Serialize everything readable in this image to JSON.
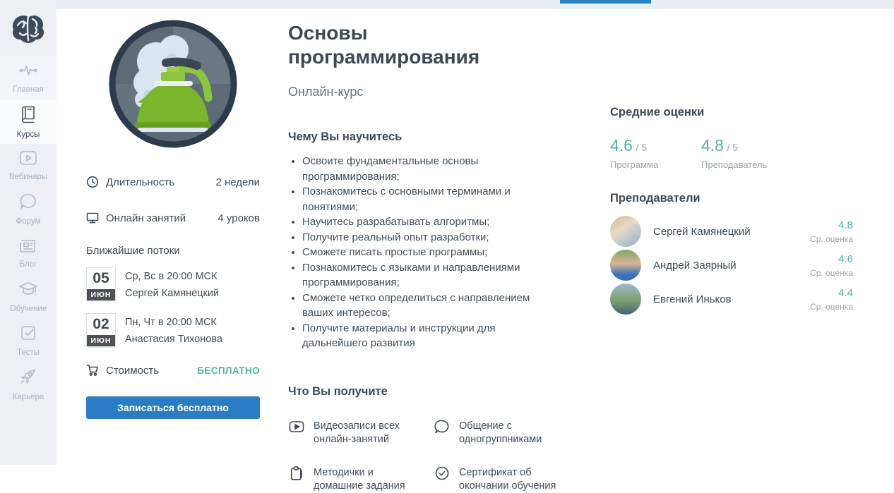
{
  "sidebar": {
    "items": [
      {
        "label": "Главная",
        "icon": "pulse-icon"
      },
      {
        "label": "Курсы",
        "icon": "book-icon"
      },
      {
        "label": "Вебинары",
        "icon": "webinar-icon"
      },
      {
        "label": "Форум",
        "icon": "forum-icon"
      },
      {
        "label": "Блог",
        "icon": "blog-icon"
      },
      {
        "label": "Обучение",
        "icon": "education-icon"
      },
      {
        "label": "Тесты",
        "icon": "tests-icon"
      },
      {
        "label": "Карьера",
        "icon": "career-icon"
      }
    ]
  },
  "header": {
    "title": "Основы программирования",
    "subtitle": "Онлайн-курс"
  },
  "course_info": {
    "duration_label": "Длительность",
    "duration_value": "2 недели",
    "lessons_label": "Онлайн занятий",
    "lessons_value": "4 уроков",
    "streams_title": "Ближайшие потоки",
    "streams": [
      {
        "day": "05",
        "month": "ИЮН",
        "schedule": "Ср, Вс в 20:00 МСК",
        "teacher": "Сергей Камянецкий"
      },
      {
        "day": "02",
        "month": "ИЮН",
        "schedule": "Пн, Чт в 20:00 МСК",
        "teacher": "Анастасия Тихонова"
      }
    ],
    "cost_label": "Стоимость",
    "cost_value": "БЕСПЛАТНО",
    "enroll_button": "Записаться бесплатно"
  },
  "learn": {
    "title": "Чему Вы научитесь",
    "items": [
      "Освоите фундаментальные основы программирования;",
      "Познакомитесь с основными терминами и понятиями;",
      "Научитесь разрабатывать алгоритмы;",
      "Получите реальный опыт разработки;",
      "Сможете писать простые программы;",
      "Познакомитесь с языками и направлениями программирования;",
      "Сможете четко определиться с направлением ваших интересов;",
      "Получите материалы и инструкции для дальнейшего развития"
    ]
  },
  "benefits": {
    "title": "Что Вы получите",
    "items": [
      {
        "icon": "video-record-icon",
        "text": "Видеозаписи всех онлайн-занятий"
      },
      {
        "icon": "chat-icon",
        "text": "Общение с одногруппниками"
      },
      {
        "icon": "materials-icon",
        "text": "Методички и домашние задания"
      },
      {
        "icon": "certificate-icon",
        "text": "Сертификат об окончании обучения"
      }
    ]
  },
  "ratings": {
    "title": "Средние оценки",
    "items": [
      {
        "value": "4.6",
        "max": "/ 5",
        "label": "Программа"
      },
      {
        "value": "4.8",
        "max": "/ 5",
        "label": "Преподаватель"
      }
    ]
  },
  "teachers": {
    "title": "Преподаватели",
    "items": [
      {
        "name": "Сергей Камянецкий",
        "rating": "4.8",
        "rating_label": "Ср. оценка"
      },
      {
        "name": "Андрей Заярный",
        "rating": "4.6",
        "rating_label": "Ср. оценка"
      },
      {
        "name": "Евгений Иньков",
        "rating": "4.4",
        "rating_label": "Ср. оценка"
      }
    ]
  },
  "colors": {
    "accent_teal": "#4cb2a8",
    "button_blue": "#2a7dc2",
    "banner_blue": "#2a80c1",
    "dark_text": "#3e4a56"
  }
}
